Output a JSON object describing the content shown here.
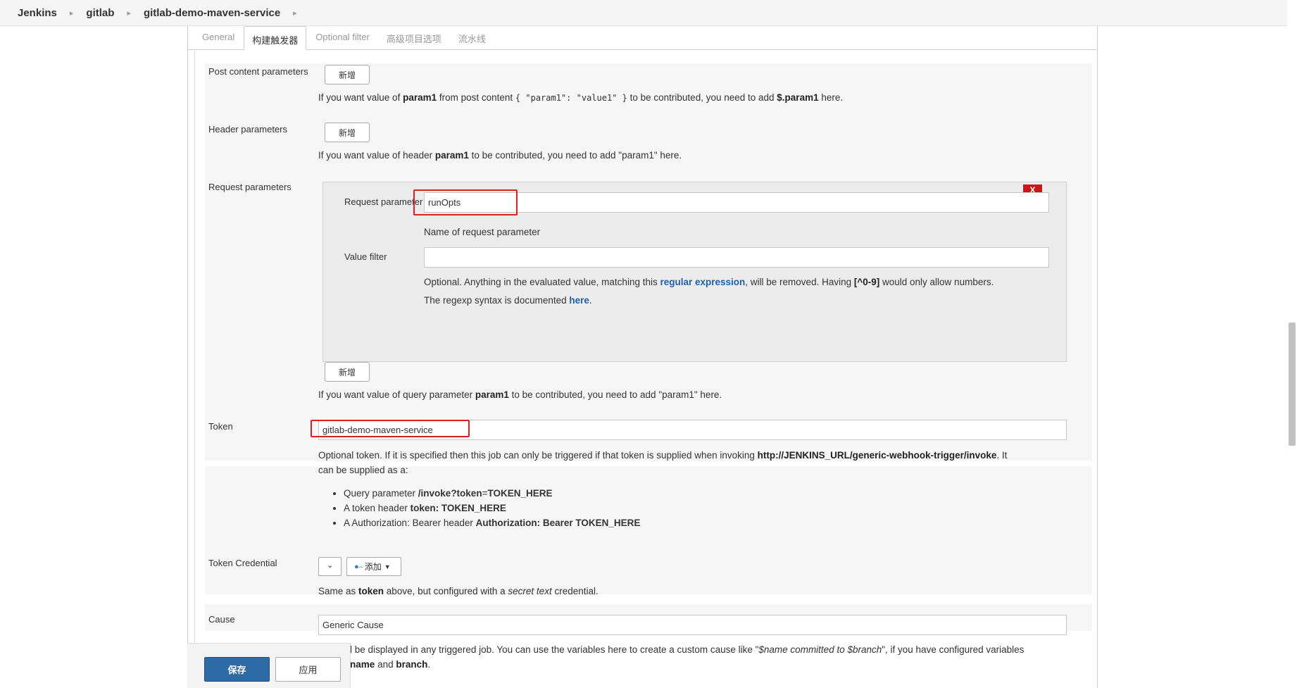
{
  "breadcrumb": [
    "Jenkins",
    "gitlab",
    "gitlab-demo-maven-service"
  ],
  "tabs": [
    "General",
    "构建触发器",
    "Optional filter",
    "高级项目选项",
    "流水线"
  ],
  "active_tab": "构建触发器",
  "post_content": {
    "label": "Post content parameters",
    "add_button": "新增",
    "help_1": "If you want value of ",
    "help_param": "param1",
    "help_2": " from post content ",
    "help_json": "{ \"param1\": \"value1\" }",
    "help_3": " to be contributed, you need to add ",
    "help_path": "$.param1",
    "help_4": " here."
  },
  "header_params": {
    "label": "Header parameters",
    "add_button": "新增",
    "help_1": "If you want value of header ",
    "help_param": "param1",
    "help_2": " to be contributed, you need to add \"param1\" here."
  },
  "request_params": {
    "label": "Request parameters",
    "delete_button": "X",
    "param_label": "Request parameter",
    "param_value": "runOpts",
    "param_help": "Name of request parameter",
    "filter_label": "Value filter",
    "filter_value": "",
    "filter_help_1": "Optional. Anything in the evaluated value, matching this ",
    "filter_help_link": "regular expression",
    "filter_help_2": ", will be removed. Having ",
    "filter_help_regex": "[^0-9]",
    "filter_help_3": " would only allow numbers.",
    "syntax_help_1": "The regexp syntax is documented ",
    "syntax_help_link": "here",
    "syntax_help_2": ".",
    "add_button": "新增",
    "help_1": "If you want value of query parameter ",
    "help_param": "param1",
    "help_2": " to be contributed, you need to add \"param1\" here."
  },
  "token": {
    "label": "Token",
    "value": "gitlab-demo-maven-service",
    "help_1": "Optional token. If it is specified then this job can only be triggered if that token is supplied when invoking ",
    "help_url": "http://JENKINS_URL/generic-webhook-trigger/invoke",
    "help_2": ". It",
    "help_3": "can be supplied as a:",
    "bullets": [
      {
        "text": "Query parameter ",
        "bold": "/invoke?token",
        "rest": "=",
        "bold2": "TOKEN_HERE"
      },
      {
        "text": "A token header ",
        "bold": "token: TOKEN_HERE",
        "rest": "",
        "bold2": ""
      },
      {
        "text": "A Authorization: Bearer header ",
        "bold": "Authorization: Bearer TOKEN_HERE",
        "rest": "",
        "bold2": ""
      }
    ]
  },
  "token_credential": {
    "label": "Token Credential",
    "add_button": "添加",
    "help_1": "Same as ",
    "help_bold": "token",
    "help_2": " above, but configured with a ",
    "help_italic": "secret text",
    "help_3": " credential."
  },
  "cause": {
    "label": "Cause",
    "value": "Generic Cause",
    "help_1": "This will be displayed in any triggered job. You can use the variables here to create a custom cause like \"",
    "help_italic": "$name committed to $branch",
    "help_2": "\", if you have configured variables",
    "help_3": "named ",
    "help_b1": "name",
    "help_4": " and ",
    "help_b2": "branch",
    "help_5": "."
  },
  "footer": {
    "save": "保存",
    "apply": "应用"
  }
}
